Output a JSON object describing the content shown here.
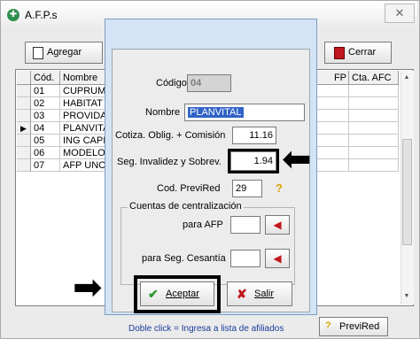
{
  "window": {
    "title": "A.F.P.s",
    "close_glyph": "✕"
  },
  "toolbar": {
    "add_label": "Agregar",
    "close_label": "Cerrar"
  },
  "grid": {
    "headers": {
      "code": "Cód.",
      "name": "Nombre",
      "fp": "FP",
      "afc": "Cta. AFC"
    },
    "rows": [
      {
        "code": "01",
        "name": "CUPRUM"
      },
      {
        "code": "02",
        "name": "HABITAT"
      },
      {
        "code": "03",
        "name": "PROVIDA"
      },
      {
        "code": "04",
        "name": "PLANVITA",
        "current": true
      },
      {
        "code": "05",
        "name": "ING CAPIT"
      },
      {
        "code": "06",
        "name": "MODELO"
      },
      {
        "code": "07",
        "name": "AFP UNO"
      }
    ]
  },
  "footer": {
    "hint": "Doble click = Ingresa a lista de afiliados",
    "previred_label": "PreviRed"
  },
  "dialog": {
    "code_label": "Código",
    "code_value": "04",
    "name_label": "Nombre",
    "name_value": "PLANVITAL",
    "cotiza_label": "Cotiza. Oblig. + Comisión",
    "cotiza_value": "11.16",
    "seg_label": "Seg. Invalidez y Sobrev.",
    "seg_value": "1.94",
    "previred_label": "Cod. PreviRed",
    "previred_value": "29",
    "help_glyph": "?",
    "group_title": "Cuentas de centralización",
    "afp_label": "para AFP",
    "afp_value": "",
    "cesantia_label": "para Seg. Cesantía",
    "cesantia_value": "",
    "accept_label": "Aceptar",
    "exit_label": "Salir"
  }
}
